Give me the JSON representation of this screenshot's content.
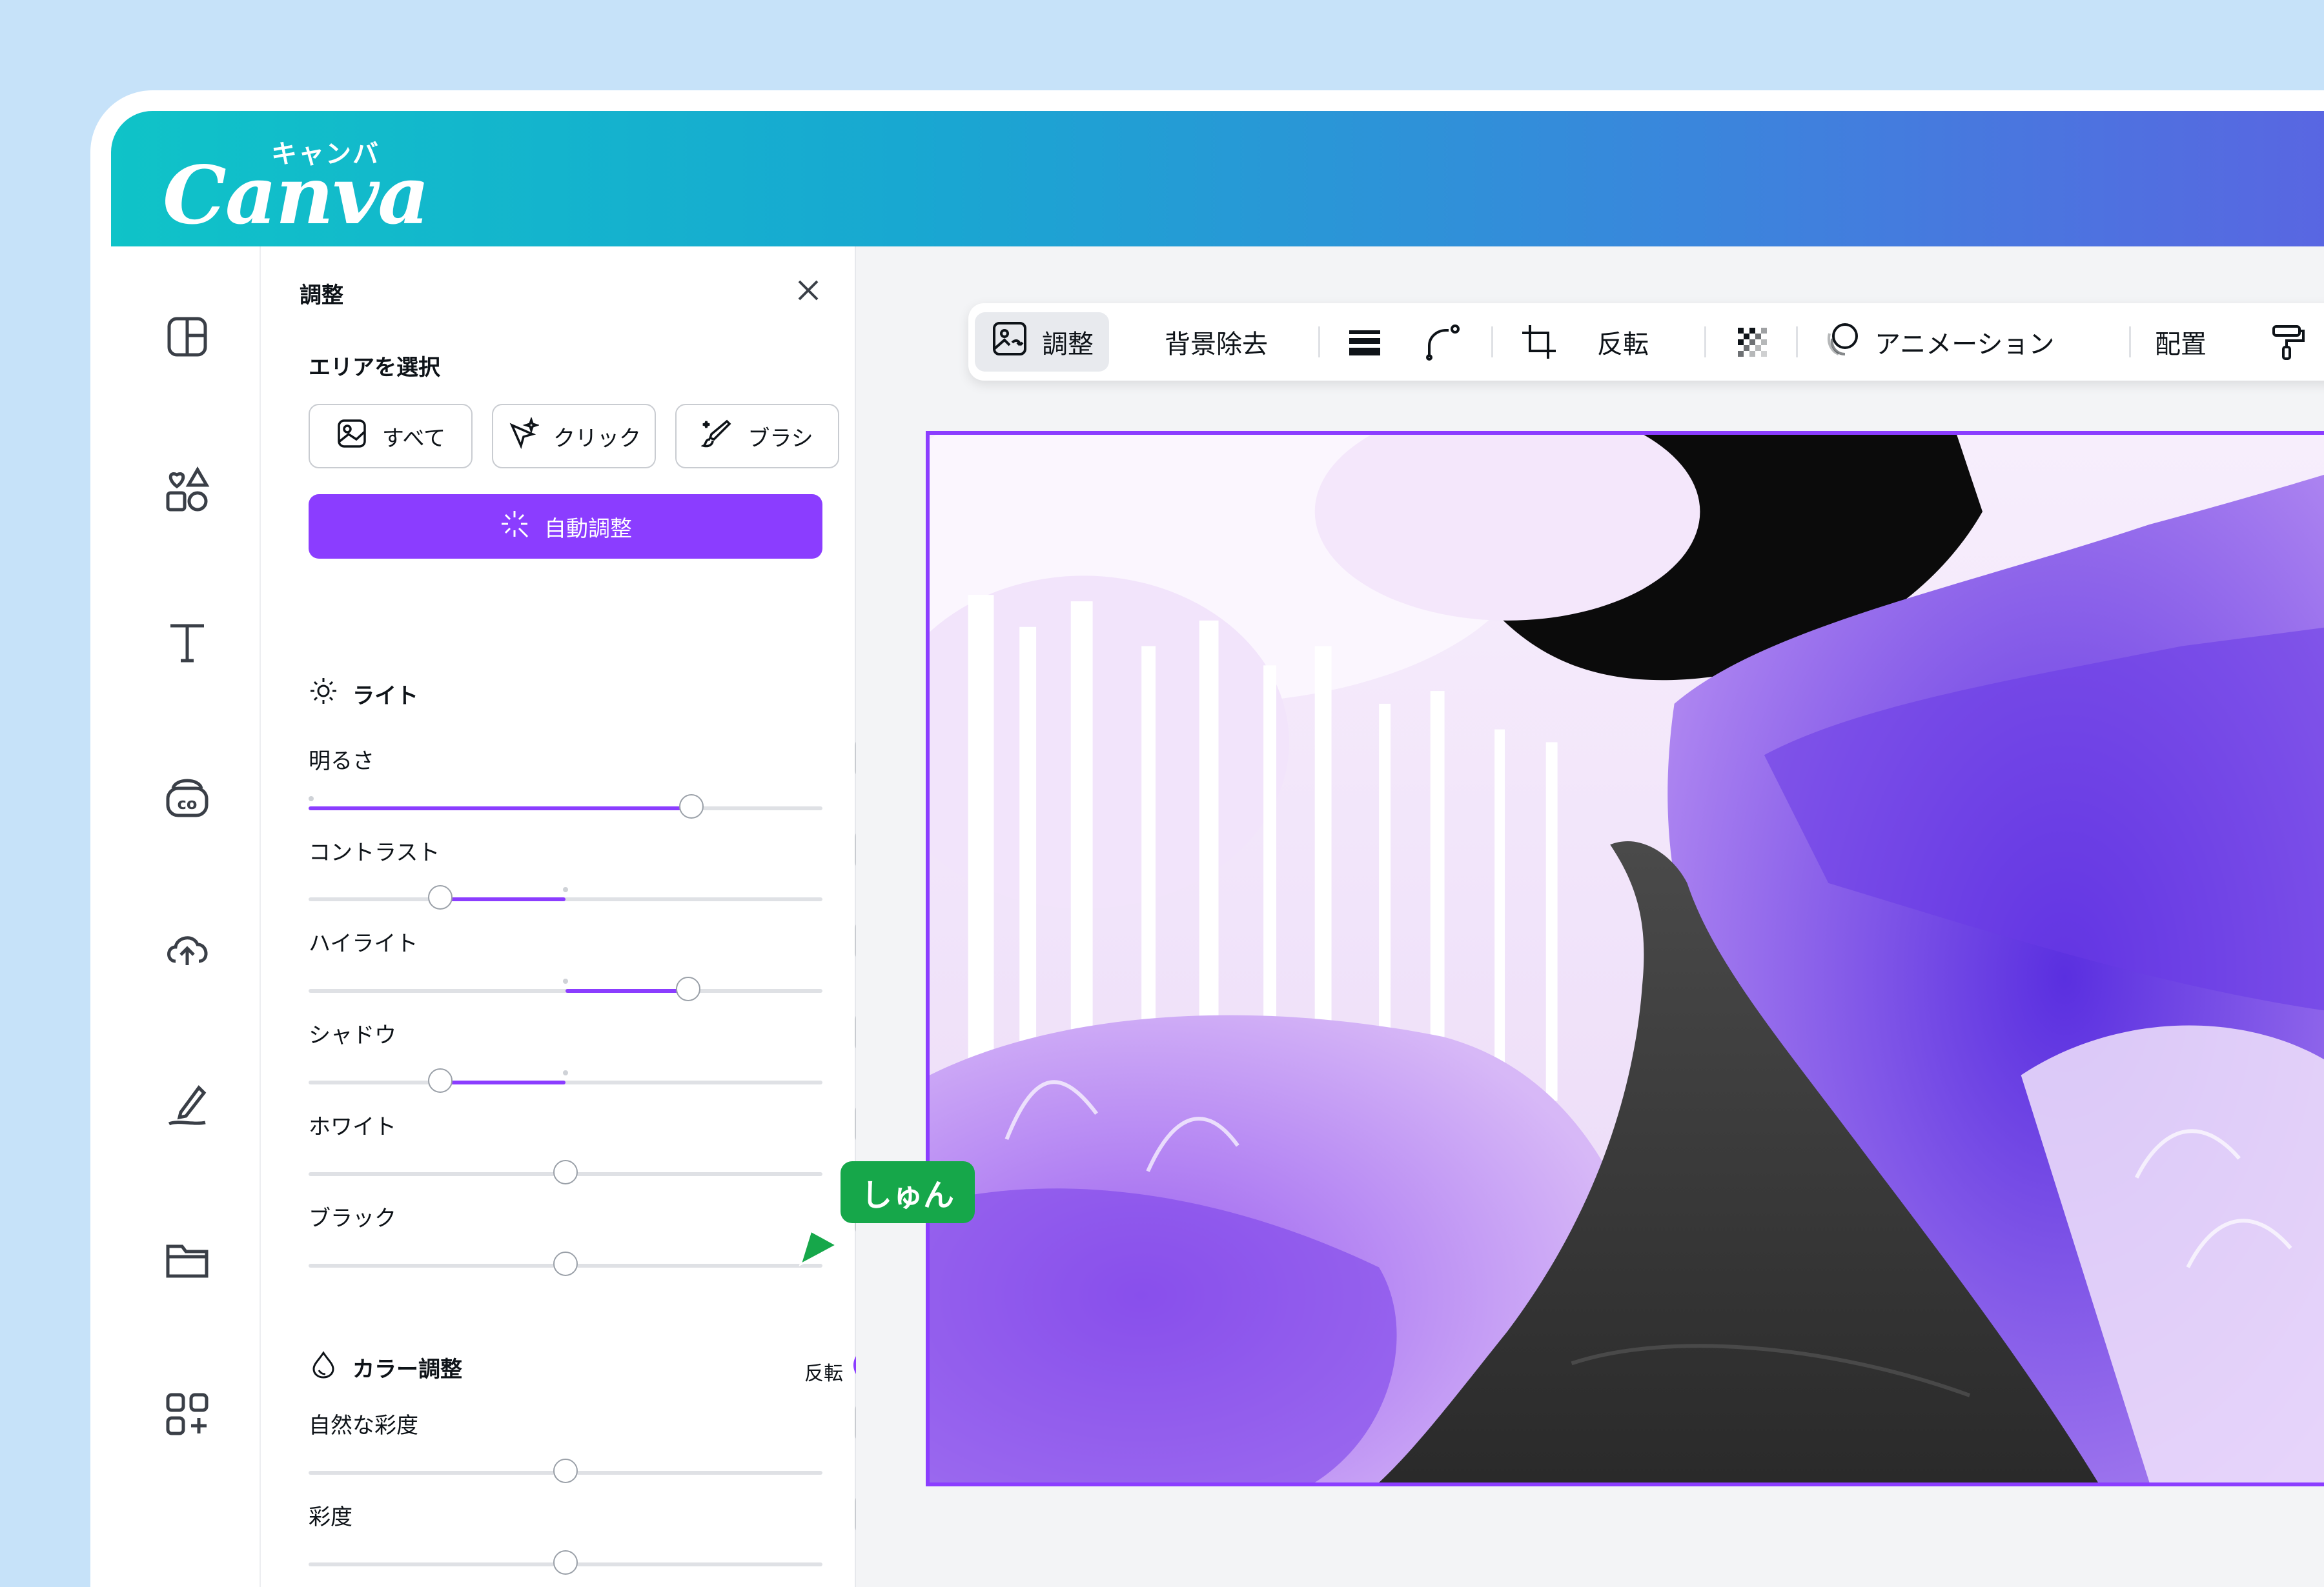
{
  "app": {
    "logo_text": "Canva",
    "logo_kana": "キャンバ"
  },
  "rail": {
    "items": [
      {
        "icon": "layout-icon"
      },
      {
        "icon": "elements-icon"
      },
      {
        "icon": "text-icon"
      },
      {
        "icon": "brand-icon"
      },
      {
        "icon": "upload-icon"
      },
      {
        "icon": "draw-icon"
      },
      {
        "icon": "projects-icon"
      },
      {
        "icon": "apps-icon"
      }
    ]
  },
  "panel": {
    "title": "調整",
    "area_heading": "エリアを選択",
    "area_buttons": [
      {
        "label": "すべて",
        "icon": "image-icon"
      },
      {
        "label": "クリック",
        "icon": "magic-click-icon"
      },
      {
        "label": "ブラシ",
        "icon": "brush-icon"
      }
    ],
    "auto_adjust_label": "自動調整",
    "light": {
      "heading": "ライト",
      "controls": [
        {
          "label": "明るさ",
          "value": "8"
        },
        {
          "label": "コントラスト",
          "value": "-3"
        },
        {
          "label": "ハイライト",
          "value": "3"
        },
        {
          "label": "シャドウ",
          "value": "-3"
        },
        {
          "label": "ホワイト",
          "value": "0"
        },
        {
          "label": "ブラック",
          "value": "0"
        }
      ]
    },
    "color": {
      "heading": "カラー調整",
      "invert_label": "反転",
      "invert_on": true,
      "controls": [
        {
          "label": "自然な彩度",
          "value": "0"
        },
        {
          "label": "彩度",
          "value": "0"
        }
      ]
    }
  },
  "collaborator": {
    "name": "しゅん",
    "color": "#16a74a"
  },
  "toolbar": {
    "items": [
      {
        "label": "調整",
        "icon": "adjust-image-icon",
        "active": true
      },
      {
        "label": "背景除去"
      },
      {
        "icon": "lines-icon"
      },
      {
        "icon": "corner-radius-icon"
      },
      {
        "icon": "crop-icon"
      },
      {
        "label": "反転"
      },
      {
        "icon": "transparency-icon"
      },
      {
        "label": "アニメーション",
        "icon": "animation-icon"
      },
      {
        "label": "配置"
      },
      {
        "icon": "paint-roller-icon"
      }
    ]
  },
  "colors": {
    "accent": "#8b3dff",
    "background": "#c6e2f9",
    "header_gradient_start": "#0fc3c8",
    "header_gradient_end": "#5b64e2"
  }
}
